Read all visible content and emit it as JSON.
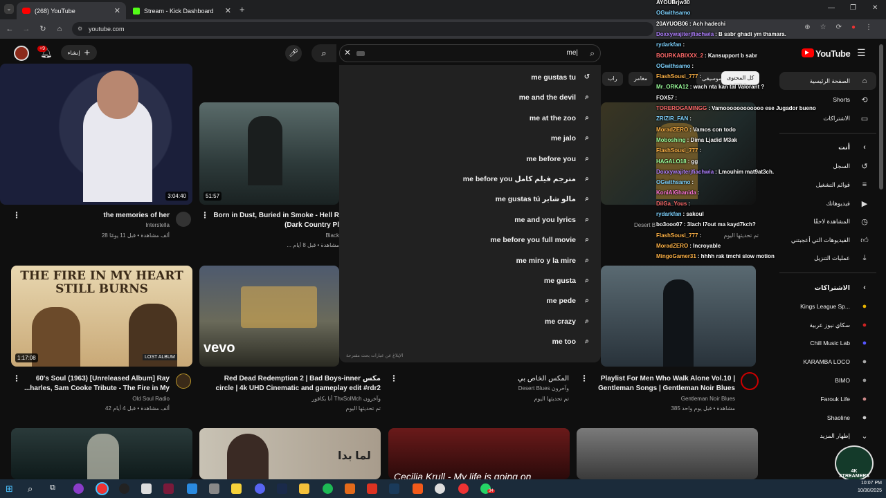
{
  "browser": {
    "tabs": [
      {
        "label": "(268) YouTube",
        "active": true
      },
      {
        "label": "Stream - Kick Dashboard",
        "active": false
      }
    ],
    "url": "youtube.com"
  },
  "youtube": {
    "logo": "YouTube",
    "search_query": "me|",
    "create_label": "إنشاء",
    "notif_count": "+9",
    "suggestions": [
      {
        "text": "me gustas tu",
        "icon": "history-icon"
      },
      {
        "text": "me and the devil",
        "icon": "search-icon"
      },
      {
        "text": "me at the zoo",
        "icon": "search-icon"
      },
      {
        "text": "me jalo",
        "icon": "search-icon"
      },
      {
        "text": "me before you",
        "icon": "search-icon"
      },
      {
        "text": "me before you مترجم فيلم كامل",
        "icon": "search-icon"
      },
      {
        "text": "me gustas tú مالو شابر",
        "icon": "search-icon"
      },
      {
        "text": "me and you lyrics",
        "icon": "search-icon"
      },
      {
        "text": "me before you full movie",
        "icon": "search-icon"
      },
      {
        "text": "me miro y la mire",
        "icon": "search-icon"
      },
      {
        "text": "me gusta",
        "icon": "search-icon"
      },
      {
        "text": "me pede",
        "icon": "search-icon"
      },
      {
        "text": "me crazy",
        "icon": "search-icon"
      },
      {
        "text": "me too",
        "icon": "search-icon"
      }
    ],
    "report_text": "الإبلاغ عن عبارات بحث مقترحة",
    "chips": [
      "كل المحتوى",
      "موسيقى",
      "راب",
      "مغامر"
    ],
    "sidebar": {
      "main": [
        "الصفحة الرئيسية",
        "Shorts",
        "الاشتراكات"
      ],
      "you_header": "أنت",
      "you": [
        "السجل",
        "قوائم التشغيل",
        "فيديوهاتك",
        "المشاهدة لاحقًا",
        "الفيديوهات التي أعجبتني",
        "عمليات التنزيل"
      ],
      "subs_header": "الاشتراكات",
      "subs": [
        "Kings League Sp...",
        "سكاي نيوز عربية",
        "Chill Music Lab",
        "KARAMBA LOCO",
        "BIMO",
        "Farouk Life",
        "Shaoline"
      ],
      "show_more": "إظهار المزيد"
    },
    "videos_row1": [
      {
        "title": "the memories of her",
        "channel": "Interstella",
        "meta": "28 ألف مشاهدة • قبل 11 يومًا",
        "duration": "3:04:40"
      },
      {
        "title": "Born in Dust, Buried in Smoke - Hell R",
        "title2": "(Dark Country Pl",
        "channel": "Black",
        "meta": "... مشاهدة • قبل 8 أيام",
        "duration": "51:57"
      },
      {
        "title": "",
        "channel": "Desert B",
        "meta": "تم تحديثها اليوم",
        "duration": ""
      }
    ],
    "videos_row2": [
      {
        "title": "60's Soul (1963) [Unreleased Album] Ray",
        "title2": "...harles, Sam Cooke Tribute - The Fire in My",
        "channel": "Old Soul Radio",
        "meta": "42 ألف مشاهدة • قبل 4 أيام",
        "duration": "1:17:08",
        "thumb_text": "THE FIRE IN MY HEART STILL BURNS",
        "badge": "LOST ALBUM"
      },
      {
        "title": "Red Dead Redemption 2 | Bad Boys-inner مكس",
        "title2": "circle | 4k UHD Cinematic and gameplay edit #rdr2",
        "channel": "أنا بكاقور ThxSolMch وآخرون",
        "meta": "تم تحديثها اليوم",
        "duration": "",
        "thumb_text": "vevo"
      },
      {
        "title": "المكس الخاص بي",
        "channel": "Desert Blues وآخرون",
        "meta": "تم تحديثها اليوم",
        "duration": ""
      },
      {
        "title": "Playlist For Men Who Walk Alone Vol.10 |",
        "title2": "Gentleman Songs | Gentleman Noir Blues",
        "channel": "Gentleman Noir Blues",
        "meta": "385 مشاهدة • قبل يوم واحد",
        "duration": ""
      }
    ],
    "row3_texts": [
      "لما بدا",
      "Cecilia Krull - My life is going on"
    ]
  },
  "chat": [
    {
      "user": "AYOUBrjw30",
      "msg": "",
      "color": "#ffffff"
    },
    {
      "user": "OGwithsamo",
      "msg": "",
      "color": "#7fd3ff"
    },
    {
      "user": "20AYUOB06",
      "msg": ": Ach hadechi",
      "color": "#ffffff"
    },
    {
      "user": "Doxxywajiterjfiachwia",
      "msg": ": B sabr ghadi ym thamara.",
      "color": "#b080ff"
    },
    {
      "user": "rydarkfan",
      "msg": ":",
      "color": "#7fd3ff"
    },
    {
      "user": "BOURKABIXXX_2",
      "msg": ": Kansupport b sabr",
      "color": "#ff6b6b"
    },
    {
      "user": "OGwithsamo",
      "msg": ":",
      "color": "#7fd3ff"
    },
    {
      "user": "FlashSousi_777",
      "msg": ":",
      "color": "#ffb347"
    },
    {
      "user": "Mr_ORKA12",
      "msg": ": wach nta kan tal Valorant ?",
      "color": "#9cff9c"
    },
    {
      "user": "FOX57",
      "msg": ":",
      "color": "#ffffff"
    },
    {
      "user": "TOREROGAMINGG",
      "msg": ": Vamoooooooooooo ese Jugador bueno",
      "color": "#ff6b6b"
    },
    {
      "user": "ZRIZIR_FAN",
      "msg": ":",
      "color": "#7fd3ff"
    },
    {
      "user": "MoradZERO",
      "msg": ": Vamos con todo",
      "color": "#ffb347"
    },
    {
      "user": "Moboshing",
      "msg": ": Dima Ljadid M3ak",
      "color": "#9cff9c"
    },
    {
      "user": "FlashSousi_777",
      "msg": ":",
      "color": "#ffb347"
    },
    {
      "user": "HAGALO18",
      "msg": ": gg",
      "color": "#9cff9c"
    },
    {
      "user": "Doxxywajiterjfiachwia",
      "msg": ": Lmouhim mat9at3ch.",
      "color": "#b080ff"
    },
    {
      "user": "OGwithsamo",
      "msg": ":",
      "color": "#7fd3ff"
    },
    {
      "user": "KoniAlGhanida",
      "msg": ":",
      "color": "#ff77d9"
    },
    {
      "user": "DilGa_Yous",
      "msg": ":",
      "color": "#ff6b6b"
    },
    {
      "user": "rydarkfan",
      "msg": ": sakoul",
      "color": "#7fd3ff"
    },
    {
      "user": "bo3ooo07",
      "msg": ": 3lach l7out ma kayd7kch?",
      "color": "#ffffff"
    },
    {
      "user": "FlashSousi_777",
      "msg": ":",
      "color": "#ffb347"
    },
    {
      "user": "MoradZERO",
      "msg": ": Incroyable",
      "color": "#ffb347"
    },
    {
      "user": "MingoGamer31",
      "msg": ": hhhh rak tmchi slow motion",
      "color": "#ffb347"
    }
  ],
  "taskbar": {
    "time": "10:07 PM",
    "date": "10/30/2025",
    "badge": "34"
  },
  "watermark": "4K STREAMERS"
}
